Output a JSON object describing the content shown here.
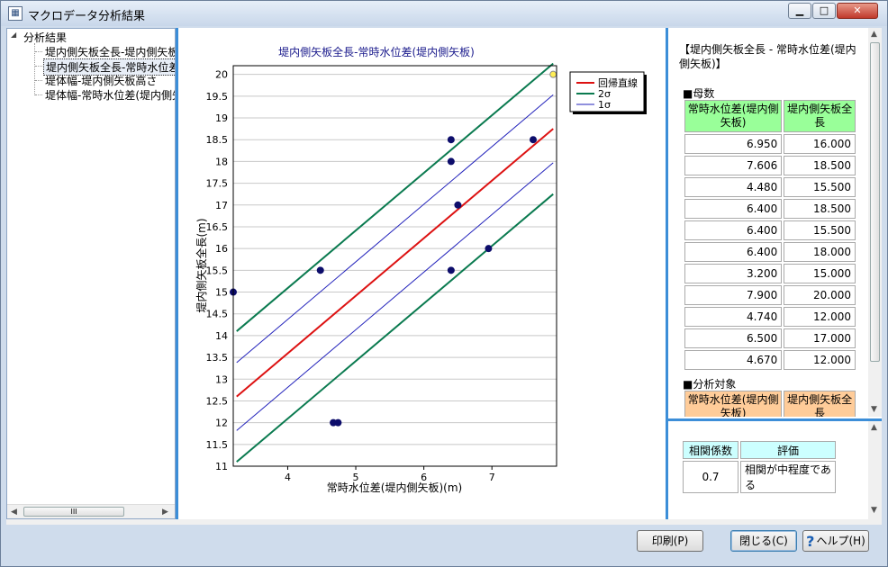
{
  "window": {
    "title": "マクロデータ分析結果",
    "minimize_glyph": "▁",
    "maximize_glyph": "□",
    "close_glyph": "✕"
  },
  "tree": {
    "root": "分析結果",
    "expand_glyph": "◢",
    "items": [
      "堤内側矢板全長-堤内側矢板高さ",
      "堤内側矢板全長-常時水位差(堤内側矢板)",
      "堤体幅-堤内側矢板高さ",
      "堤体幅-常時水位差(堤内側矢板)"
    ],
    "selected_index": 1,
    "scroll_left": "◀",
    "scroll_right": "▶",
    "thumb_grip": "III"
  },
  "chart_data": {
    "type": "scatter",
    "title": "堤内側矢板全長-常時水位差(堤内側矢板)",
    "xlabel": "常時水位差(堤内側矢板)(m)",
    "ylabel": "堤内側矢板全長(m)",
    "xlim": [
      3.2,
      7.95
    ],
    "ylim": [
      11,
      20.2
    ],
    "x_ticks": [
      "4",
      "5",
      "6",
      "7"
    ],
    "x_tick_values": [
      4,
      5,
      6,
      7
    ],
    "y_ticks": [
      "11",
      "11.5",
      "12",
      "12.5",
      "13",
      "13.5",
      "14",
      "14.5",
      "15",
      "15.5",
      "16",
      "16.5",
      "17",
      "17.5",
      "18",
      "18.5",
      "19",
      "19.5",
      "20"
    ],
    "y_tick_values": [
      11,
      11.5,
      12,
      12.5,
      13,
      13.5,
      14,
      14.5,
      15,
      15.5,
      16,
      16.5,
      17,
      17.5,
      18,
      18.5,
      19,
      19.5,
      20
    ],
    "grid": "horizontal",
    "legend_position": "top-right",
    "points": [
      {
        "x": 6.95,
        "y": 16.0
      },
      {
        "x": 7.606,
        "y": 18.5
      },
      {
        "x": 4.48,
        "y": 15.5
      },
      {
        "x": 6.4,
        "y": 18.5
      },
      {
        "x": 6.4,
        "y": 15.5
      },
      {
        "x": 6.4,
        "y": 18.0
      },
      {
        "x": 3.2,
        "y": 15.0
      },
      {
        "x": 7.9,
        "y": 20.0
      },
      {
        "x": 4.74,
        "y": 12.0
      },
      {
        "x": 6.5,
        "y": 17.0
      },
      {
        "x": 4.67,
        "y": 12.0
      }
    ],
    "point_color": "#0d0d6b",
    "highlight_point_index": 7,
    "highlight_color": "#ffee55",
    "regression": {
      "name": "回帰直線",
      "color": "#dd1111",
      "x": [
        3.25,
        7.9
      ],
      "y": [
        12.6,
        18.75
      ]
    },
    "sigma2": {
      "name": "2σ",
      "color": "#0a7a4f",
      "offset": 1.5
    },
    "sigma1": {
      "name": "1σ",
      "color": "#2222bb",
      "offset": 0.78
    }
  },
  "info": {
    "heading": "【堤内側矢板全長 - 常時水位差(堤内側矢板)】",
    "population_label": "■母数",
    "col1_header": "常時水位差(堤内側矢板)",
    "col2_header": "堤内側矢板全長",
    "rows": [
      [
        "6.950",
        "16.000"
      ],
      [
        "7.606",
        "18.500"
      ],
      [
        "4.480",
        "15.500"
      ],
      [
        "6.400",
        "18.500"
      ],
      [
        "6.400",
        "15.500"
      ],
      [
        "6.400",
        "18.000"
      ],
      [
        "3.200",
        "15.000"
      ],
      [
        "7.900",
        "20.000"
      ],
      [
        "4.740",
        "12.000"
      ],
      [
        "6.500",
        "17.000"
      ],
      [
        "4.670",
        "12.000"
      ]
    ],
    "target_label": "■分析対象",
    "target_col1_header": "常時水位差(堤内側矢板)",
    "target_col2_header": "堤内側矢板全長",
    "scroll_up": "▲",
    "scroll_down": "▼"
  },
  "correlation": {
    "coef_header": "相関係数",
    "eval_header": "評価",
    "coef_value": "0.7",
    "eval_value": "相関が中程度である",
    "scroll_up": "▲",
    "scroll_down": "▼"
  },
  "buttons": {
    "print": "印刷(P)",
    "close": "閉じる(C)",
    "help": "ヘルプ(H)",
    "help_icon": "?"
  }
}
